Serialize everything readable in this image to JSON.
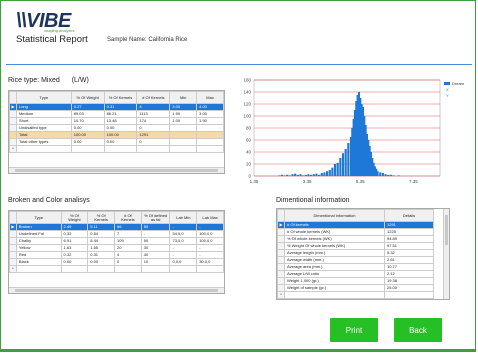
{
  "header": {
    "logo_text": "\\\\VIBE",
    "logo_sub": "imaging analytics",
    "title": "Statistical Report",
    "sample_label": "Sample Name: California Rice"
  },
  "rice_type": {
    "title": "Rice type: Mixed",
    "unit": "(L/W)",
    "columns": [
      "Type",
      "% Of Weight",
      "% Of Kernels",
      "# Of Kernels",
      "Min",
      "Max"
    ],
    "rows": [
      [
        "Long",
        "0.27",
        "0.31",
        "4",
        "3.00",
        "4.00"
      ],
      [
        "Medium",
        "89.03",
        "86.21",
        "1113",
        "1.90",
        "3.00"
      ],
      [
        "Short",
        "10.70",
        "13.48",
        "174",
        "1.00",
        "1.90"
      ],
      [
        "Undisaifed type",
        "0.00",
        "0.00",
        "0",
        "",
        ""
      ],
      [
        "Total",
        "100.00",
        "100.00",
        "1291",
        "",
        ""
      ],
      [
        "Total other types",
        "0.00",
        "0.00",
        "0",
        "",
        ""
      ]
    ]
  },
  "broken": {
    "title": "Broken and Color analisys",
    "columns": [
      "Type",
      "% Of Weight",
      "% Of Kernels",
      "# Of Kernels",
      "% Of defined as fal",
      "Lab Min",
      "Lab Max"
    ],
    "rows": [
      [
        "Broken",
        "2.49",
        "5.11",
        "66",
        "50",
        "-",
        "-"
      ],
      [
        "Undefined Fal",
        "0.32",
        "0.54",
        "7",
        "-",
        "54,0,0",
        "100,0,0"
      ],
      [
        "Chalky",
        "6.91",
        "8.44",
        "109",
        "50",
        "73,0,0",
        "100,0,0"
      ],
      [
        "Yellow",
        "1.63",
        "1.55",
        "20",
        "30",
        "-",
        "-"
      ],
      [
        "Red",
        "0.32",
        "0.31",
        "4",
        "40",
        "-",
        "-"
      ],
      [
        "Black",
        "0.00",
        "0.00",
        "0",
        "10",
        "0,0,0",
        "30,0,0"
      ]
    ]
  },
  "dimensional": {
    "title": "Dimentional information",
    "columns": [
      "Dimentional information",
      "Details"
    ],
    "rows": [
      [
        "# Of kernels",
        "1291"
      ],
      [
        "# Of whole kernels (WK)",
        "1225"
      ],
      [
        "% Of whole kernels (WK)",
        "94.89"
      ],
      [
        "% Weight Of whole kernels (WK)",
        "97.51"
      ],
      [
        "Average length (mm.)",
        "5.32"
      ],
      [
        "Average width (mm.)",
        "2.61"
      ],
      [
        "Average area (mm.)",
        "10.77"
      ],
      [
        "Average L/W ratio",
        "2.12"
      ],
      [
        "Weight 1,000 (gr.)",
        "19.38"
      ],
      [
        "Weight of sample (gr.)",
        "25.00"
      ]
    ]
  },
  "buttons": {
    "print": "Print",
    "back": "Back"
  },
  "colors": {
    "accent_green": "#26c026",
    "bar_blue": "#1e78d8",
    "selected_row": "#1e78d8",
    "total_row": "#f5d9a8",
    "red_line": "#d03030"
  },
  "chart_data": {
    "type": "bar",
    "x_ticks": [
      "1.35",
      "3.35",
      "5.35",
      "7.35"
    ],
    "y_ticks": [
      "0",
      "20",
      "40",
      "60",
      "80",
      "100",
      "120",
      "140",
      "160"
    ],
    "ylim": [
      0,
      160
    ],
    "xlim": [
      1.35,
      8.35
    ],
    "bin_width": 0.05,
    "series": [
      {
        "name": "Dream",
        "x": [
          2.3,
          2.4,
          2.5,
          2.6,
          2.7,
          2.8,
          2.9,
          3.0,
          3.1,
          3.2,
          3.3,
          3.4,
          3.5,
          3.6,
          3.7,
          3.8,
          3.9,
          4.0,
          4.1,
          4.2,
          4.3,
          4.4,
          4.5,
          4.6,
          4.7,
          4.8,
          4.9,
          5.0,
          5.05,
          5.1,
          5.15,
          5.2,
          5.25,
          5.3,
          5.35,
          5.4,
          5.45,
          5.5,
          5.55,
          5.6,
          5.65,
          5.7,
          5.75,
          5.8,
          5.85,
          5.9,
          5.95,
          6.0,
          6.1,
          6.2,
          6.3,
          6.4,
          6.5,
          6.6,
          6.8
        ],
        "values": [
          1,
          2,
          1,
          2,
          1,
          3,
          4,
          2,
          3,
          1,
          2,
          3,
          2,
          3,
          4,
          2,
          5,
          6,
          8,
          10,
          14,
          20,
          22,
          30,
          38,
          45,
          55,
          65,
          80,
          95,
          110,
          125,
          135,
          140,
          130,
          120,
          115,
          100,
          85,
          70,
          60,
          50,
          40,
          30,
          22,
          16,
          12,
          8,
          6,
          5,
          3,
          2,
          2,
          1,
          1
        ]
      },
      {
        "name": "X",
        "x": [],
        "values": []
      },
      {
        "name": "Y",
        "x": [],
        "values": []
      }
    ],
    "red_lines_y": [
      0,
      20,
      40,
      60,
      80,
      100,
      120,
      140,
      160
    ],
    "legend": "top-right"
  }
}
